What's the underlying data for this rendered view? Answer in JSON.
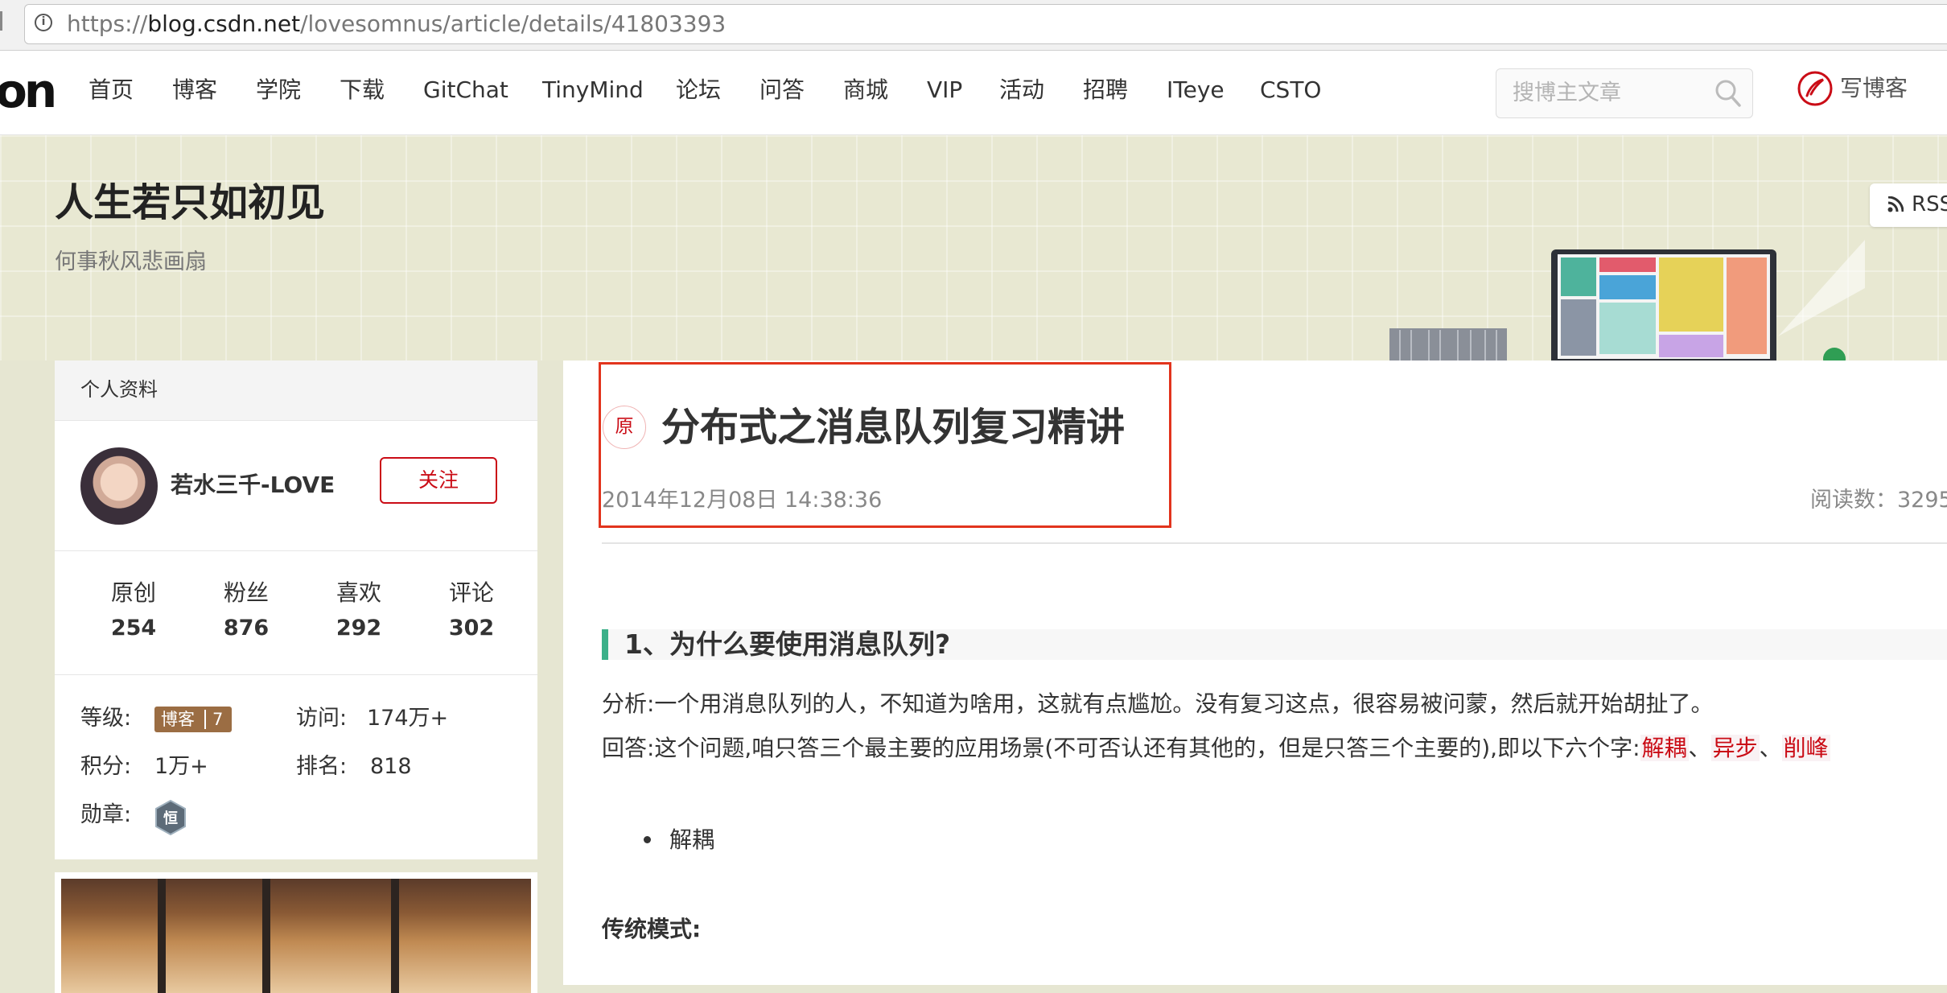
{
  "browser": {
    "url_prefix": "https://",
    "url_host": "blog.csdn.net",
    "url_path": "/lovesomnus/article/details/41803393"
  },
  "nav": {
    "logo": "on",
    "items": [
      "首页",
      "博客",
      "学院",
      "下载",
      "GitChat",
      "TinyMind",
      "论坛",
      "问答",
      "商城",
      "VIP",
      "活动",
      "招聘",
      "ITeye",
      "CSTO"
    ],
    "search_placeholder": "搜博主文章",
    "write_label": "写博客"
  },
  "banner": {
    "title": "人生若只如初见",
    "subtitle": "何事秋风悲画扇",
    "rss_label": "RSS"
  },
  "profile": {
    "header": "个人资料",
    "username": "若水三千-LOVE",
    "follow_label": "关注",
    "stats": [
      {
        "label": "原创",
        "value": "254"
      },
      {
        "label": "粉丝",
        "value": "876"
      },
      {
        "label": "喜欢",
        "value": "292"
      },
      {
        "label": "评论",
        "value": "302"
      }
    ],
    "level_label": "等级:",
    "level_badge": "博客",
    "level_num": "7",
    "visits_label": "访问:",
    "visits_value": "174万+",
    "points_label": "积分:",
    "points_value": "1万+",
    "rank_label": "排名:",
    "rank_value": "818",
    "medal_label": "勋章:",
    "medal_glyph": "恒"
  },
  "article": {
    "orig_badge": "原",
    "title": "分布式之消息队列复习精讲",
    "date": "2014年12月08日 14:38:36",
    "reads": "阅读数：3295",
    "h2": "1、为什么要使用消息队列?",
    "p1": "分析:一个用消息队列的人，不知道为啥用，这就有点尴尬。没有复习这点，很容易被问蒙，然后就开始胡扯了。",
    "p2_prefix": "回答:这个问题,咱只答三个最主要的应用场景(不可否认还有其他的，但是只答三个主要的),即以下六个字:",
    "kw1": "解耦",
    "sep1": "、",
    "kw2": "异步",
    "sep2": "、",
    "kw3": "削峰",
    "bullet1": "解耦",
    "subhead": "传统模式:"
  },
  "colors": {
    "accent_red": "#ca0c16",
    "highlight_box": "#e2341d",
    "h2_accent": "#3cb089",
    "level_badge_bg": "#9b6d43"
  },
  "icons": [
    "info-icon",
    "search-icon",
    "write-pen-icon",
    "rss-icon",
    "medal-icon"
  ]
}
